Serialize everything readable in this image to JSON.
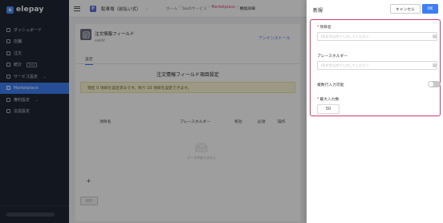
{
  "brand": {
    "name": "elepay",
    "mark": "e"
  },
  "sidebar": {
    "items": [
      {
        "label": "ダッシュボード",
        "active": false
      },
      {
        "label": "店舗",
        "active": false
      },
      {
        "label": "注文",
        "active": false
      },
      {
        "label": "統計",
        "badge": "Beta",
        "active": false
      },
      {
        "label": "サービス設定",
        "chevron": "⌄",
        "active": false
      },
      {
        "label": "Marketplace",
        "active": true
      },
      {
        "label": "権利設定",
        "chevron": "⌄",
        "active": false
      },
      {
        "label": "言語設定",
        "active": false
      }
    ]
  },
  "topbar": {
    "store_mark": "P",
    "store_name": "駐車場（前払い式）",
    "store_chevron": "⌄",
    "breadcrumb": [
      "ホーム",
      "SaaSサービス",
      "Marketplace",
      "機能詳細"
    ],
    "breadcrumb_sep": "/"
  },
  "app": {
    "title": "注文情報フィールド",
    "subtitle": "elePAY",
    "uninstall": "アンインストール",
    "tab": "設定"
  },
  "section": {
    "title": "注文情報フィールド項目設定",
    "notice": "現在 0 項目を設定済みです。残り 10 項目を設定できます。",
    "columns": [
      "項目名",
      "プレースホルダー",
      "有効",
      "必須",
      "操作"
    ],
    "empty_text": "データがありません",
    "add": "+",
    "save": "保存"
  },
  "drawer": {
    "title": "新規",
    "cancel": "キャンセル",
    "ok": "OK",
    "fields": {
      "name_label": "項目名",
      "name_placeholder": "60文字以内で入力してください",
      "placeholder_label": "プレースホルダー",
      "placeholder_placeholder": "60文字以内で入力してください",
      "multiline_label": "複数行入力可能",
      "multiline_enabled": false,
      "maxlen_label": "最大入力数",
      "maxlen_value": "50"
    }
  },
  "colors": {
    "accent": "#3d7ff3",
    "highlight_border": "#c83a6d",
    "sidebar_bg": "#1f2633"
  }
}
